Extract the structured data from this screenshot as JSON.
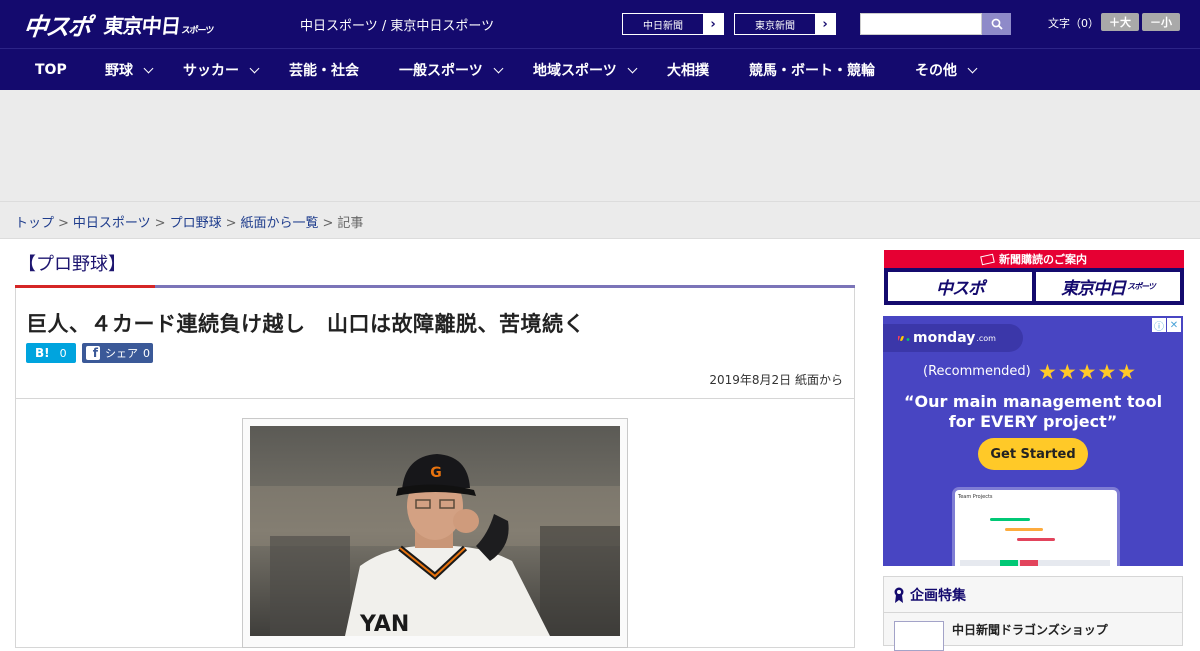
{
  "header": {
    "logo_main": "中スポ",
    "logo_tokyo": "東京中日",
    "logo_tokyo_suffix": "スポーツ",
    "site_title": "中日スポーツ / 東京中日スポーツ",
    "paper_links": [
      {
        "label": "中日新聞",
        "arrow": "›"
      },
      {
        "label": "東京新聞",
        "arrow": "›"
      }
    ],
    "search": {
      "placeholder": "",
      "icon": "search-icon"
    },
    "font_size": {
      "label": "文字（0）",
      "increase": "＋大",
      "decrease": "－小"
    }
  },
  "nav": {
    "items": [
      {
        "label": "TOP",
        "dropdown": false
      },
      {
        "label": "野球",
        "dropdown": true
      },
      {
        "label": "サッカー",
        "dropdown": true
      },
      {
        "label": "芸能・社会",
        "dropdown": false
      },
      {
        "label": "一般スポーツ",
        "dropdown": true
      },
      {
        "label": "地域スポーツ",
        "dropdown": true
      },
      {
        "label": "大相撲",
        "dropdown": false
      },
      {
        "label": "競馬・ボート・競輪",
        "dropdown": false
      },
      {
        "label": "その他",
        "dropdown": true
      }
    ]
  },
  "breadcrumb": {
    "items": [
      "トップ",
      "中日スポーツ",
      "プロ野球",
      "紙面から一覧"
    ],
    "current": "記事",
    "separator": ">"
  },
  "article": {
    "category": "【プロ野球】",
    "headline": "巨人、４カード連続負け越し　山口は故障離脱、苦境続く",
    "share": {
      "hatena_label": "B!",
      "hatena_count": "0",
      "fb_label": "シェア",
      "fb_count": "0"
    },
    "date": "2019年8月2日 紙面から"
  },
  "sidebar": {
    "subscribe": {
      "title": "新聞購読のご案内",
      "logo_left": "中スポ",
      "logo_right": "東京中日",
      "logo_right_suffix": "スポーツ"
    },
    "ad": {
      "brand": "monday",
      "brand_suffix": ".com",
      "recommended": "(Recommended)",
      "stars": "★★★★★",
      "quote_line1": "“Our main management tool",
      "quote_line2": "for EVERY project”",
      "cta": "Get Started",
      "screen_title": "Team Projects"
    },
    "feature": {
      "title": "企画特集",
      "item": "中日新聞ドラゴンズショップ"
    }
  },
  "colors": {
    "navy": "#140a6e",
    "accent_red": "#d52626",
    "hatena_blue": "#00a4de",
    "fb_blue": "#3b5998",
    "ad_purple": "#4845c2"
  }
}
